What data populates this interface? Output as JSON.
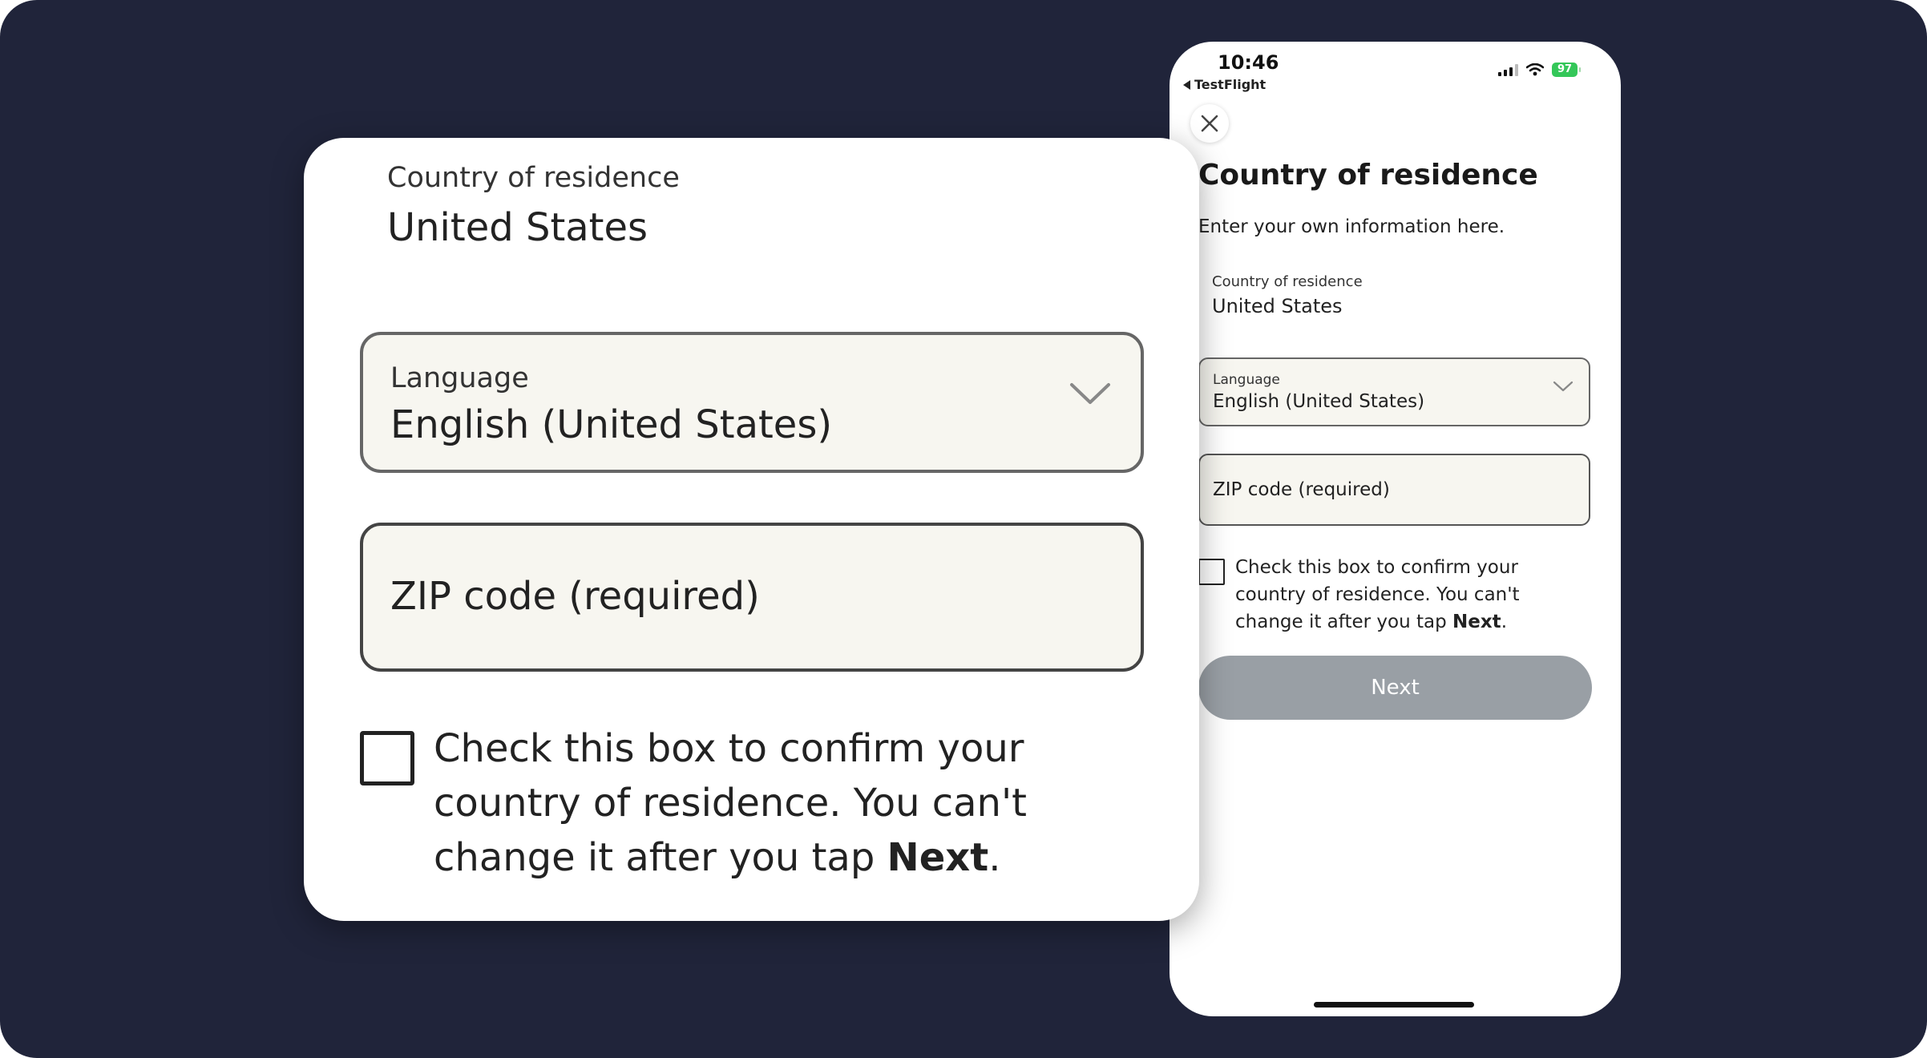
{
  "phone": {
    "status_bar": {
      "time": "10:46",
      "back_app": "TestFlight",
      "battery": "97"
    },
    "title": "Country of residence",
    "subtitle": "Enter your own information here.",
    "country_of_residence": {
      "label": "Country of residence",
      "value": "United States"
    },
    "language": {
      "label": "Language",
      "value": "English (United States)"
    },
    "zip": {
      "placeholder": "ZIP code (required)"
    },
    "confirm": {
      "text_before": "Check this box to confirm your country of residence. You can't change it after you tap ",
      "text_bold": "Next",
      "text_after": "."
    },
    "next_button": "Next"
  },
  "zoom": {
    "country_of_residence": {
      "label": "Country of residence",
      "value": "United States"
    },
    "language": {
      "label": "Language",
      "value": "English (United States)"
    },
    "zip": {
      "placeholder": "ZIP code (required)"
    },
    "confirm": {
      "text_before": "Check this box to confirm your country of residence. You can't change it after you tap ",
      "text_bold": "Next",
      "text_after": "."
    }
  },
  "colors": {
    "background": "#20243a",
    "field_background": "#f7f6f0",
    "next_button_disabled": "#999fa5",
    "battery": "#34c759"
  },
  "icons": [
    "close-icon",
    "chevron-down-icon",
    "signal-icon",
    "wifi-icon",
    "battery-icon",
    "back-arrow-icon"
  ]
}
